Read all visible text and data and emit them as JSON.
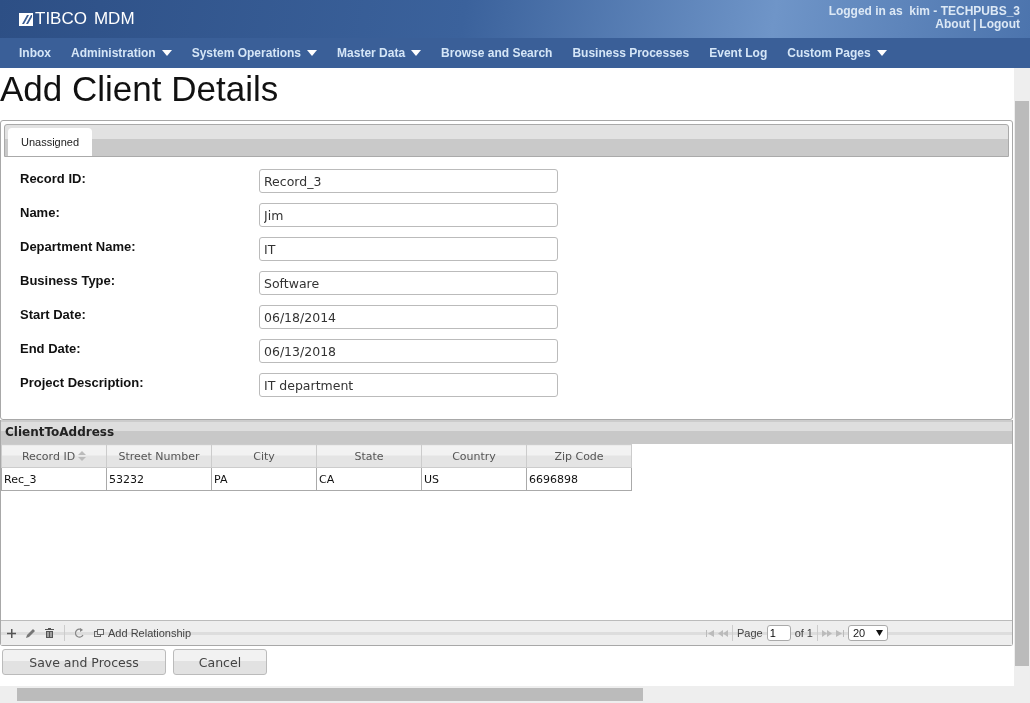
{
  "header": {
    "logo": "TIBCO",
    "product": "MDM",
    "user": "Logged in as  kim - TECHPUBS_3",
    "links": [
      "About",
      "Logout"
    ],
    "separator": "|"
  },
  "nav": [
    {
      "label": "Inbox",
      "dropdown": false
    },
    {
      "label": "Administration",
      "dropdown": true
    },
    {
      "label": "System Operations",
      "dropdown": true
    },
    {
      "label": "Master Data",
      "dropdown": true
    },
    {
      "label": "Browse and Search",
      "dropdown": false
    },
    {
      "label": "Business Processes",
      "dropdown": false
    },
    {
      "label": "Event Log",
      "dropdown": false
    },
    {
      "label": "Custom Pages",
      "dropdown": true
    }
  ],
  "title": "Add Client Details",
  "tabs": [
    {
      "label": "Unassigned",
      "selected": true
    }
  ],
  "fields": [
    {
      "label": "Record ID:",
      "value": "Record_3"
    },
    {
      "label": "Name:",
      "value": "Jim"
    },
    {
      "label": "Department Name:",
      "value": "IT"
    },
    {
      "label": "Business Type:",
      "value": "Software"
    },
    {
      "label": "Start Date:",
      "value": "06/18/2014"
    },
    {
      "label": "End Date:",
      "value": "06/13/2018"
    },
    {
      "label": "Project Description:",
      "value": "IT department"
    }
  ],
  "grid": {
    "title": "ClientToAddress",
    "columns": [
      {
        "label": "Record ID",
        "sortable": true
      },
      {
        "label": "Street Number",
        "sortable": false
      },
      {
        "label": "City",
        "sortable": false
      },
      {
        "label": "State",
        "sortable": false
      },
      {
        "label": "Country",
        "sortable": false
      },
      {
        "label": "Zip Code",
        "sortable": false
      }
    ],
    "rows": [
      [
        "Rec_3",
        "53232",
        "PA",
        "CA",
        "US",
        "6696898"
      ]
    ],
    "toolbar": {
      "add_relationship": "Add Relationship"
    },
    "pager": {
      "page_label": "Page",
      "page": "1",
      "of_label": "of 1",
      "page_size": "20"
    }
  },
  "buttons": [
    "Save and Process",
    "Cancel"
  ]
}
